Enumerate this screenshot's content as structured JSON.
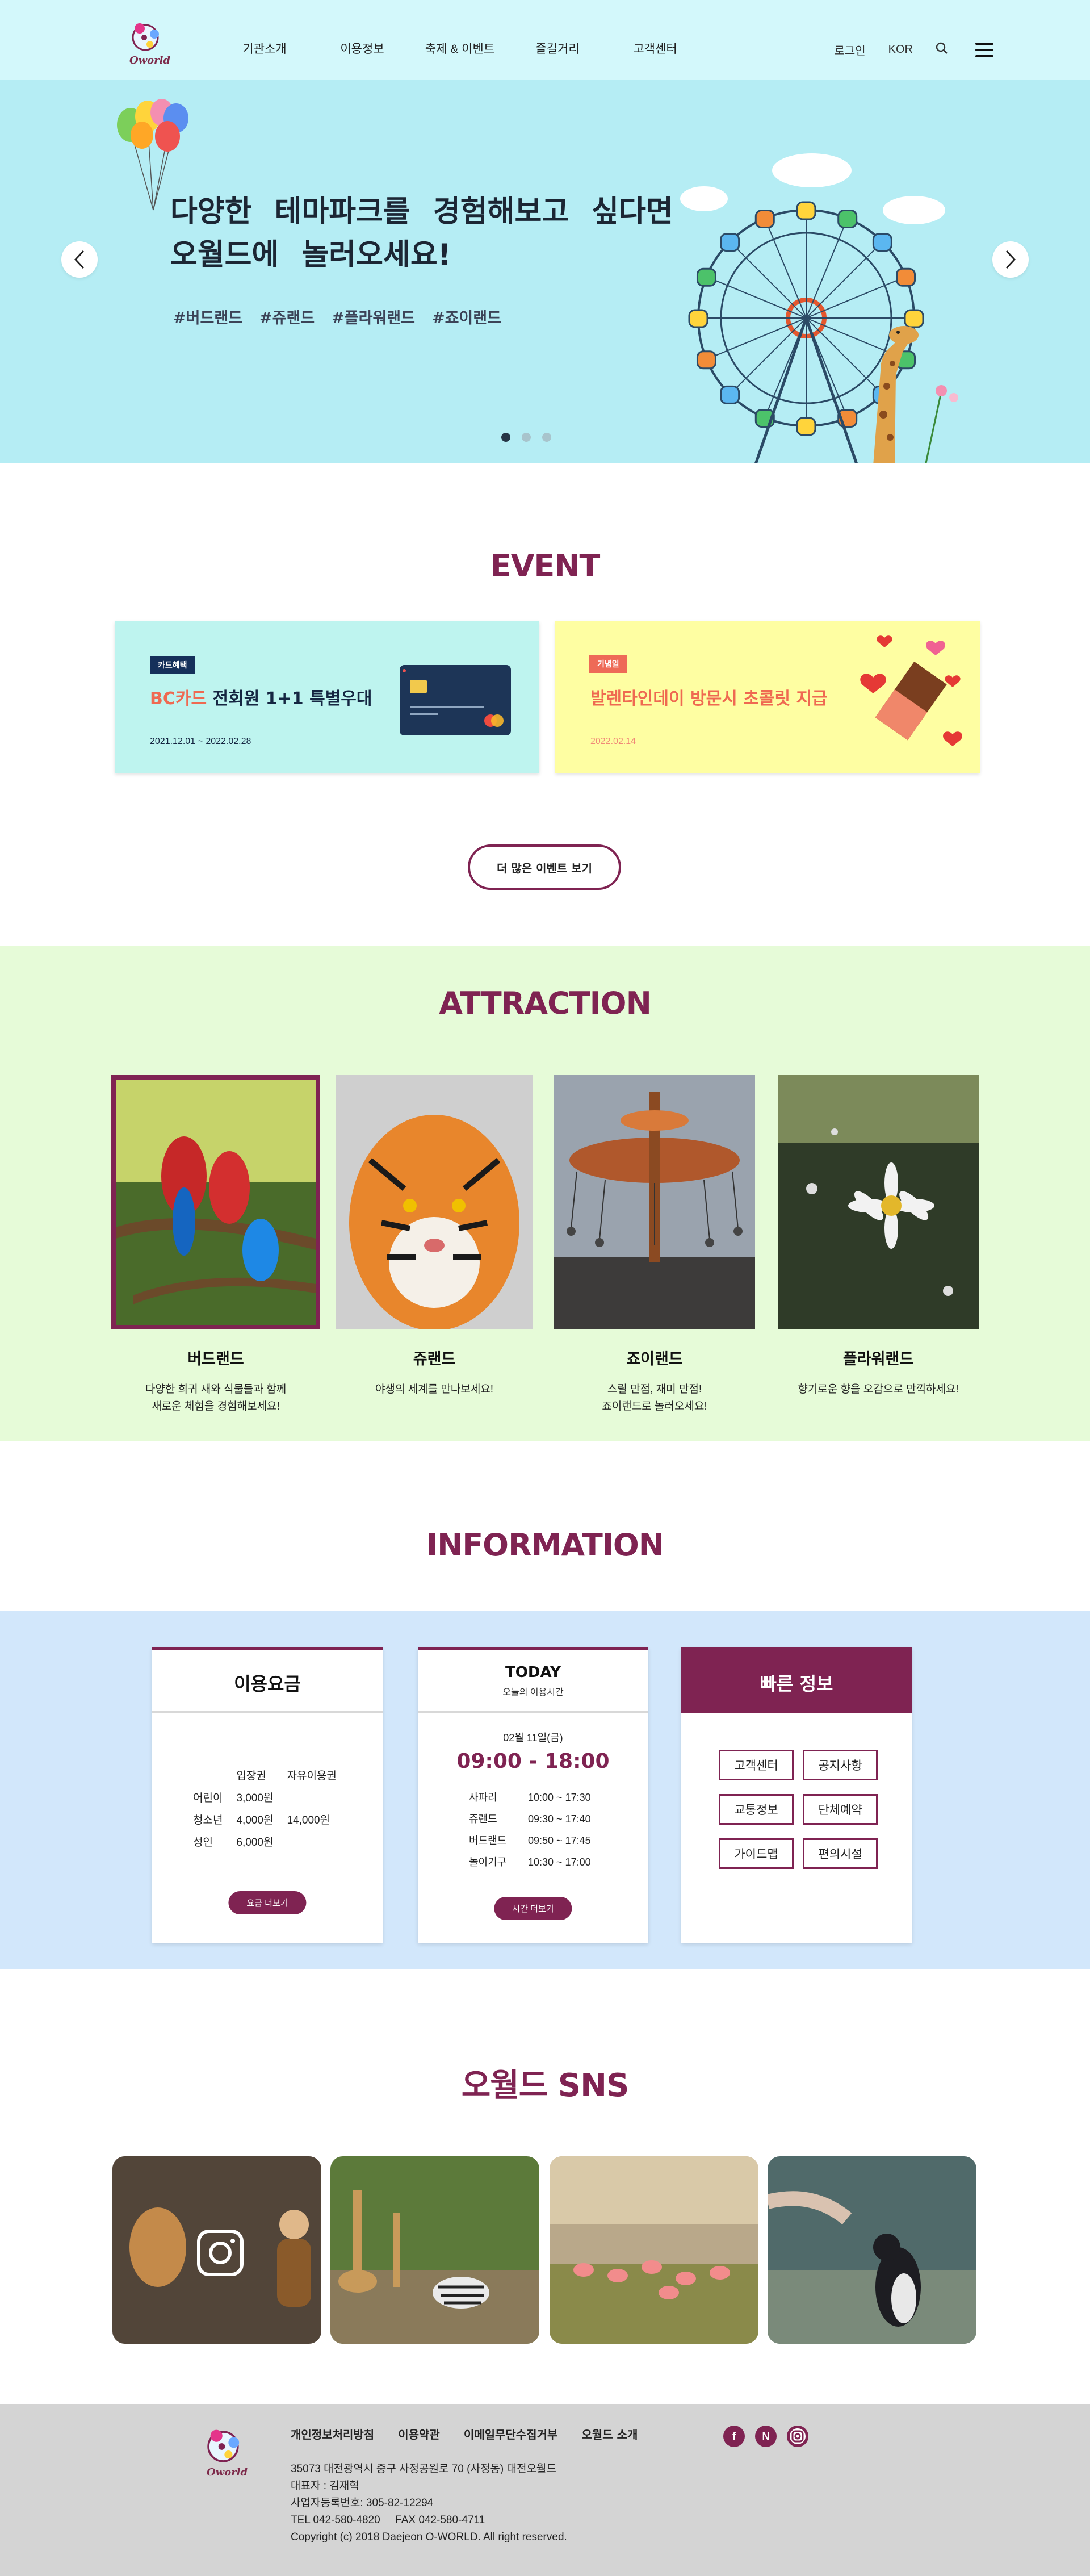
{
  "header": {
    "logo_text": "Oworld",
    "nav": [
      "기관소개",
      "이용정보",
      "축제 & 이벤트",
      "즐길거리",
      "고객센터"
    ],
    "login": "로그인",
    "lang": "KOR"
  },
  "hero": {
    "title": "다양한 테마파크를 경험해보고 싶다면\n오월드에 놀러오세요!",
    "tags": [
      "#버드랜드",
      "#쥬랜드",
      "#플라워랜드",
      "#죠이랜드"
    ],
    "slides": 3,
    "active_slide": 1
  },
  "event": {
    "title": "EVENT",
    "cards": [
      {
        "badge": "카드혜택",
        "heading_hl": "BC카드",
        "heading": " 전회원 1+1 특별우대",
        "date": "2021.12.01 ~ 2022.02.28"
      },
      {
        "badge": "기념일",
        "heading_hl": "",
        "heading": "발렌타인데이 방문시 초콜릿 지급",
        "date": "2022.02.14"
      }
    ],
    "more_button": "더 많은 이벤트 보기"
  },
  "attraction": {
    "title": "ATTRACTION",
    "items": [
      {
        "name": "버드랜드",
        "desc": "다양한 희귀 새와 식물들과 함께\n새로운 체험을 경험해보세요!",
        "selected": true
      },
      {
        "name": "쥬랜드",
        "desc": "야생의 세계를 만나보세요!",
        "selected": false
      },
      {
        "name": "죠이랜드",
        "desc": "스릴 만점, 재미 만점!\n죠이랜드로 놀러오세요!",
        "selected": false
      },
      {
        "name": "플라워랜드",
        "desc": "향기로운 향을 오감으로 만끽하세요!",
        "selected": false
      }
    ]
  },
  "information": {
    "title": "INFORMATION",
    "fees": {
      "title": "이용요금",
      "headers": [
        "입장권",
        "자유이용권"
      ],
      "rows": [
        {
          "label": "어린이",
          "ticket": "3,000원"
        },
        {
          "label": "청소년",
          "ticket": "4,000원"
        },
        {
          "label": "성인",
          "ticket": "6,000원"
        }
      ],
      "free_pass": "14,000원",
      "button": "요금 더보기"
    },
    "today": {
      "title": "TODAY",
      "subtitle": "오늘의 이용시간",
      "date": "02월 11일(금)",
      "hours": "09:00 - 18:00",
      "schedule": [
        {
          "name": "사파리",
          "time": "10:00 ~ 17:30"
        },
        {
          "name": "쥬랜드",
          "time": "09:30 ~ 17:40"
        },
        {
          "name": "버드랜드",
          "time": "09:50 ~ 17:45"
        },
        {
          "name": "놀이기구",
          "time": "10:30 ~ 17:00"
        }
      ],
      "button": "시간 더보기"
    },
    "quick": {
      "title": "빠른 정보",
      "items": [
        "고객센터",
        "공지사항",
        "교통정보",
        "단체예약",
        "가이드맵",
        "편의시설"
      ]
    }
  },
  "sns": {
    "title": "오월드 SNS"
  },
  "footer": {
    "logo_text": "Oworld",
    "links": [
      "개인정보처리방침",
      "이용약관",
      "이메일무단수집거부",
      "오월드 소개"
    ],
    "social": [
      "f",
      "N"
    ],
    "address": "35073 대전광역시 중구 사정공원로 70 (사정동) 대전오월드",
    "ceo": "대표자 : 김재혁",
    "biz": "사업자등록번호: 305-82-12294",
    "tel": "TEL 042-580-4820     FAX 042-580-4711",
    "copyright": "Copyright (c) 2018 Daejeon O-WORLD. All right reserved."
  },
  "colors": {
    "accent": "#7f2352",
    "header_bg": "#d3f8fb",
    "hero_bg": "#b5edf4",
    "attraction_bg": "#e6fbd8",
    "info_bg": "#d2e7fb",
    "footer_bg": "#d4d4d4"
  }
}
